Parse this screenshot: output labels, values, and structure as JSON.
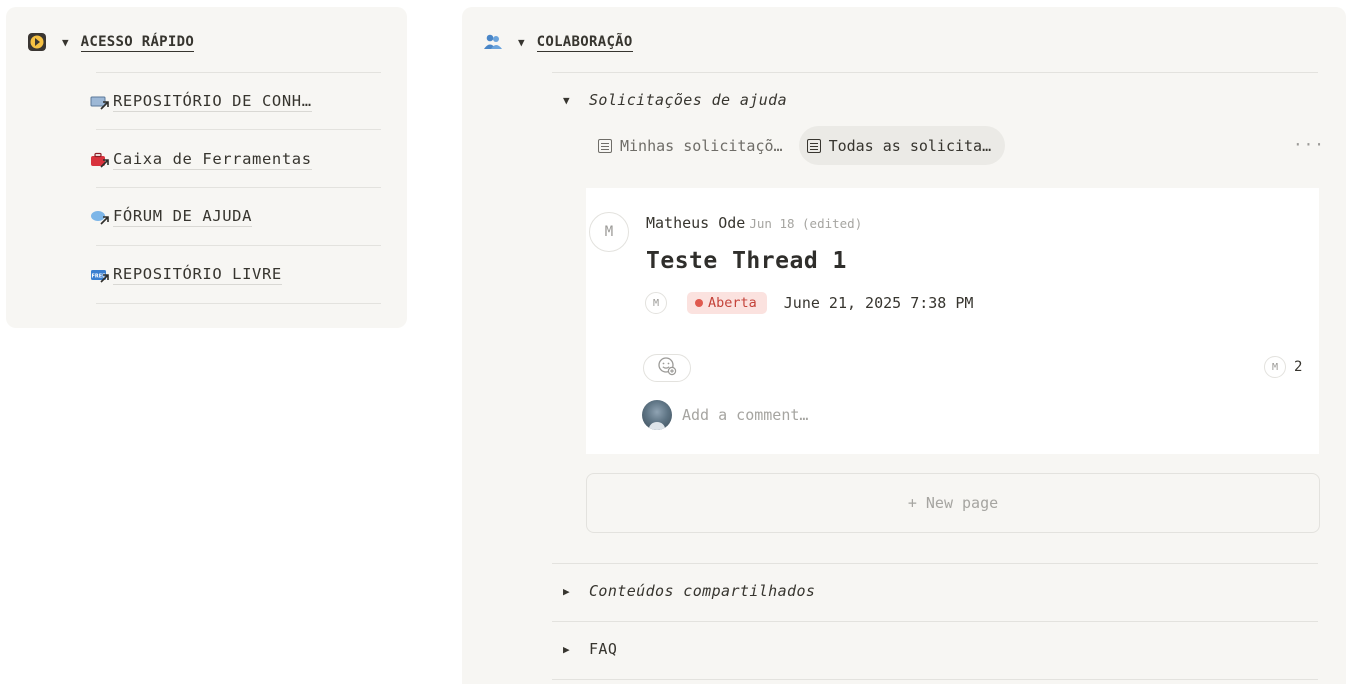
{
  "quick_access": {
    "title": "ACESSO RÁPIDO",
    "items": [
      {
        "label": "REPOSITÓRIO DE CONH…",
        "icon": "monitor-link-icon"
      },
      {
        "label": "Caixa de Ferramentas",
        "icon": "toolbox-link-icon"
      },
      {
        "label": "FÓRUM DE AJUDA",
        "icon": "speech-bubble-link-icon"
      },
      {
        "label": "REPOSITÓRIO LIVRE",
        "icon": "free-badge-link-icon"
      }
    ]
  },
  "collab": {
    "title": "COLABORAÇÃO",
    "sections": [
      {
        "label": "Solicitações de ajuda",
        "expanded": true
      },
      {
        "label": "Conteúdos compartilhados",
        "expanded": false
      },
      {
        "label": "FAQ",
        "expanded": false
      }
    ],
    "tabs": [
      {
        "label": "Minhas solicitaçõ…",
        "active": false
      },
      {
        "label": "Todas as solicita…",
        "active": true
      }
    ],
    "more": "···"
  },
  "card": {
    "avatar_initial": "M",
    "author": "Matheus Ode",
    "meta": "Jun 18 (edited)",
    "title": "Teste Thread 1",
    "assignee_initial": "M",
    "status": "Aberta",
    "date": "June 21, 2025 7:38 PM",
    "commenter_initial": "M",
    "comment_count": "2",
    "comment_placeholder": "Add a comment…"
  },
  "new_page": "+ New page",
  "colors": {
    "panel_bg": "#f7f6f3",
    "text": "#37352f",
    "status_bg": "#fbe2df",
    "status_text": "#c4433a",
    "status_dot": "#e05a4f"
  }
}
